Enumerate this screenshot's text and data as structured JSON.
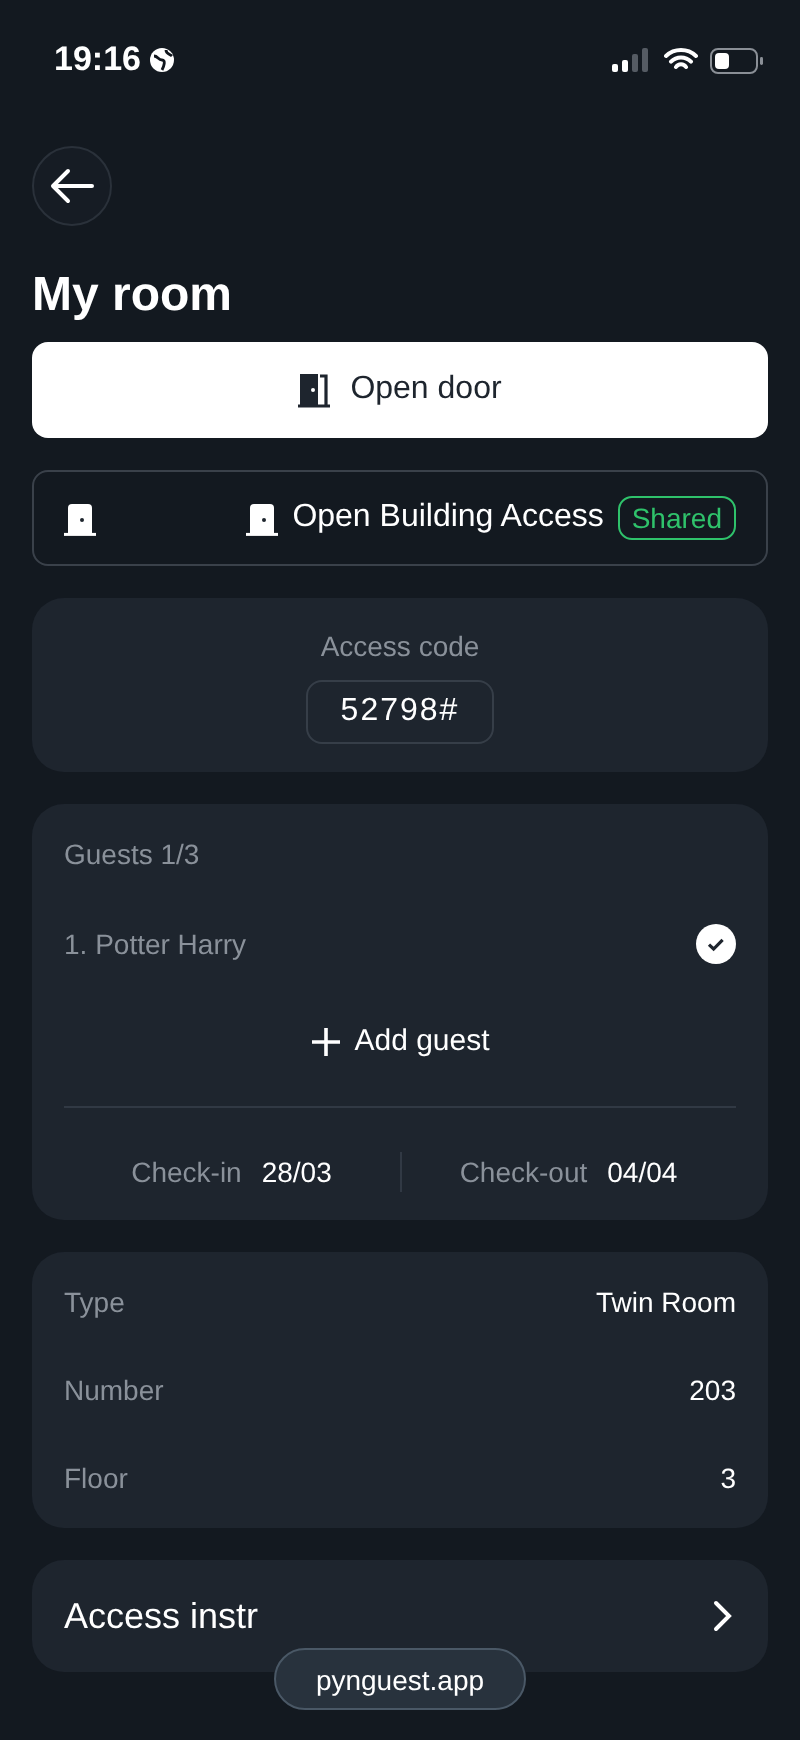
{
  "status_bar": {
    "time": "19:16"
  },
  "title": "My room",
  "open_door": {
    "label": "Open door"
  },
  "building_access": {
    "label": "Open Building Access",
    "badge": "Shared"
  },
  "access_code": {
    "label": "Access code",
    "code": "52798#"
  },
  "guests": {
    "heading": "Guests 1/3",
    "list": [
      {
        "name": "1. Potter Harry",
        "checked": true
      }
    ],
    "add_label": "Add guest",
    "check_in_label": "Check-in",
    "check_in": "28/03",
    "check_out_label": "Check-out",
    "check_out": "04/04"
  },
  "details": [
    {
      "label": "Type",
      "value": "Twin Room"
    },
    {
      "label": "Number",
      "value": "203"
    },
    {
      "label": "Floor",
      "value": "3"
    }
  ],
  "instructions": {
    "label": "Access instr"
  },
  "url_pill": {
    "text": "pynguest.app"
  }
}
